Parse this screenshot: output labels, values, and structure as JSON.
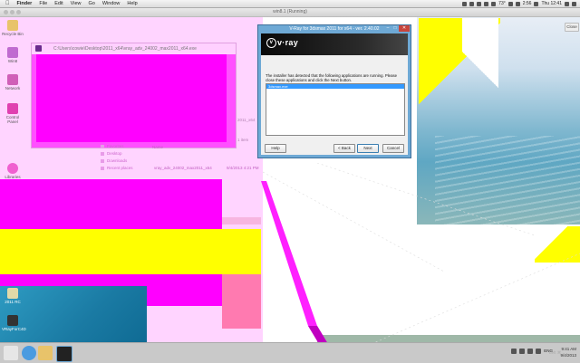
{
  "menubar": {
    "apple": "",
    "app": "Finder",
    "items": [
      "File",
      "Edit",
      "View",
      "Go",
      "Window",
      "Help"
    ],
    "status": {
      "temp": "73°",
      "battery": "2:56",
      "clock": "Thu 12:41"
    }
  },
  "vm_title": "win8.1 (Running)",
  "mac_close_button": "Close",
  "desktop_icons": [
    {
      "label": "Recycle Bin"
    },
    {
      "label": "Win8"
    },
    {
      "label": "Network"
    },
    {
      "label": "Control Panel"
    },
    {
      "label": "Libraries"
    }
  ],
  "explorer": {
    "title": "C:\\Users\\cowie\\Desktop\\2011_x64\\vray_adv_24002_max2011_x64.exe",
    "column_name": "Name",
    "nav": [
      "Favorites",
      "Desktop",
      "Downloads",
      "Recent places"
    ],
    "file_name": "vray_adv_24002_max2011_x64",
    "file_date": "9/4/2013 4:21 PM",
    "fragment_a": "2011_x64",
    "fragment_b": "1 item"
  },
  "bottom_icons": [
    {
      "label": "2011 RC"
    },
    {
      "label": "VRayForC4D"
    }
  ],
  "vray_dialog": {
    "title": "V-Ray for 3dsmax 2011 for x64 - ver. 2.40.02",
    "logo": "v·ray",
    "message": "The installer has detected that the following applications are running. Please close these applications and click the Next button.",
    "list_items": [
      "3dsmax.exe"
    ],
    "buttons": {
      "help": "Help",
      "back": "< Back",
      "next": "Next",
      "cancel": "Cancel"
    }
  },
  "taskbar": {
    "time": "9:41 AM",
    "date": "9/4/2013",
    "lang": "ENG",
    "mouse_status": "Left ⌘"
  },
  "colors": {
    "magenta": "#ff00ff",
    "yellow": "#ffff00",
    "vray_frame": "#6ea9d5",
    "selection": "#3399ff"
  }
}
